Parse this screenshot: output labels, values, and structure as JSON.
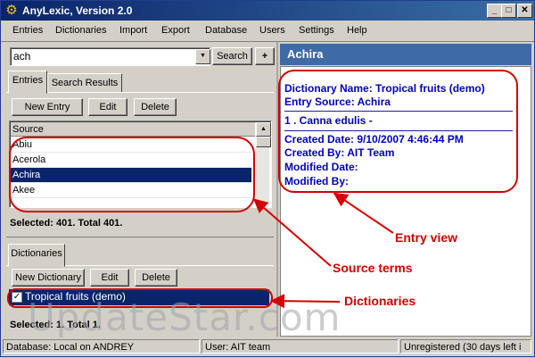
{
  "window": {
    "title": "AnyLexic, Version 2.0"
  },
  "menu": [
    "Entries",
    "Dictionaries",
    "Import",
    "Export",
    "Database",
    "Users",
    "Settings",
    "Help"
  ],
  "search": {
    "value": "ach",
    "button": "Search",
    "add_button": "+"
  },
  "tabs": {
    "entries": "Entries",
    "search_results": "Search Results",
    "dictionaries": "Dictionaries"
  },
  "entry_buttons": {
    "new": "New Entry",
    "edit": "Edit",
    "delete": "Delete"
  },
  "source_list": {
    "header": "Source",
    "items": [
      "Abiu",
      "Acerola",
      "Achira",
      "Akee"
    ],
    "selected": "Achira",
    "status": "Selected: 401. Total 401."
  },
  "dict_buttons": {
    "new": "New Dictionary",
    "edit": "Edit",
    "delete": "Delete"
  },
  "dictionaries": {
    "items": [
      {
        "name": "Tropical fruits (demo)",
        "checked": true
      }
    ],
    "status": "Selected: 1. Total 1."
  },
  "entry_view": {
    "header": "Achira",
    "dictionary_name": "Dictionary Name: Tropical fruits (demo)",
    "entry_source": "Entry Source: Achira",
    "translation": "1 . Canna edulis -",
    "created_date": "Created Date: 9/10/2007 4:46:44 PM",
    "created_by": "Created By: AIT Team",
    "modified_date": "Modified Date:",
    "modified_by": "Modified By:"
  },
  "annotations": {
    "entry_view": "Entry view",
    "source_terms": "Source terms",
    "dictionaries": "Dictionaries"
  },
  "status_bar": {
    "database": "Database: Local on ANDREY",
    "user": "User: AIT team",
    "registration": "Unregistered (30 days left i"
  },
  "watermark": "UpdateStar.com",
  "colors": {
    "title_bar": "#0a246a",
    "header_blue": "#3f6aa8",
    "selection": "#0a246a",
    "entry_text": "#0000c0",
    "annotation": "#d40000"
  }
}
